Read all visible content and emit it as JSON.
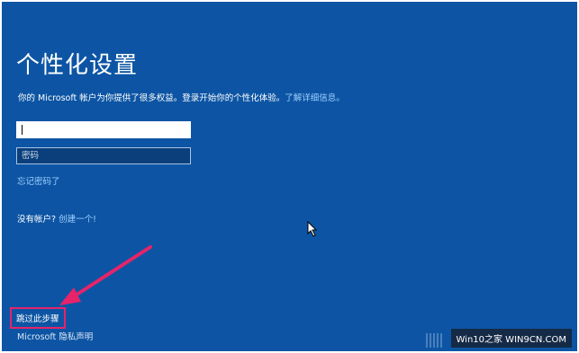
{
  "page": {
    "title": "个性化设置",
    "description": "你的 Microsoft 帐户为你提供了很多权益。登录开始你的个性化体验。",
    "learn_more_link": "了解详细信息。"
  },
  "form": {
    "email": {
      "value": "",
      "placeholder": ""
    },
    "password": {
      "value": "",
      "placeholder": "密码"
    },
    "forgot_password": "忘记密码了"
  },
  "account": {
    "no_account_text": "没有帐户?",
    "create_link": "创建一个!"
  },
  "footer": {
    "skip_label": "跳过此步骤",
    "privacy_link": "Microsoft 隐私声明"
  },
  "watermark": {
    "text": "Win10之家 WIN9CN.COM"
  },
  "colors": {
    "background": "#0d55a4",
    "link": "#9fd0ff",
    "highlight": "#e5246a"
  },
  "icons": {
    "arrow": "annotation-arrow",
    "cursor": "mouse-pointer"
  }
}
